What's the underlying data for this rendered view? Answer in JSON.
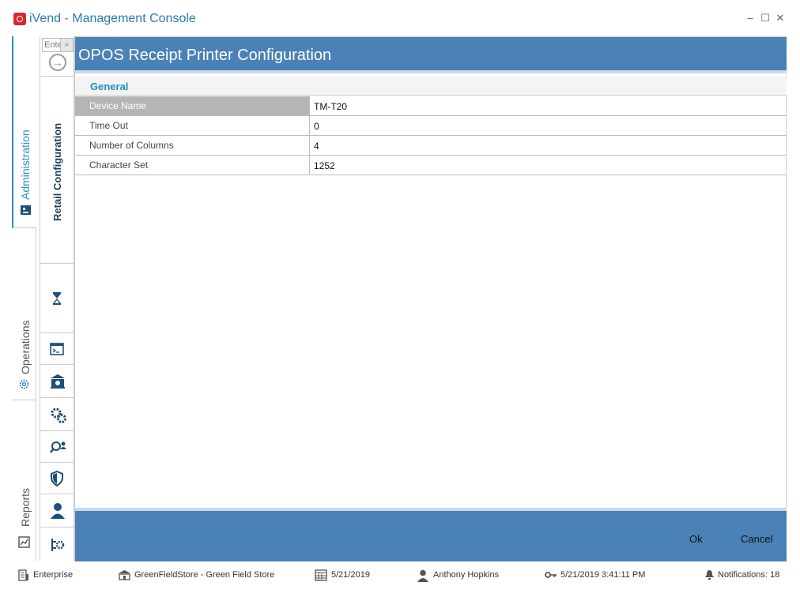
{
  "app": {
    "title": "iVend - Management Console"
  },
  "window": {
    "minimize": "‒",
    "maximize": "☐",
    "close": "✕"
  },
  "modules": [
    {
      "label": "Administration",
      "icon": "admin-icon",
      "active": true
    },
    {
      "label": "Operations",
      "icon": "gear-icon",
      "active": false
    },
    {
      "label": "Reports",
      "icon": "reports-icon",
      "active": false
    }
  ],
  "rail": {
    "search_placeholder": "Enter",
    "search_icon": "search-icon",
    "section_label": "Retail Configuration",
    "icons": [
      "hourglass-icon",
      "terminal-icon",
      "bank-icon",
      "settings-cogs-icon",
      "search-user-icon",
      "shield-icon",
      "user-icon",
      "integration-icon"
    ]
  },
  "main": {
    "title": "OPOS Receipt Printer Configuration",
    "section": "General",
    "properties": [
      {
        "label": "Device Name",
        "value": "TM-T20",
        "selected": true
      },
      {
        "label": "Time Out",
        "value": "0",
        "selected": false
      },
      {
        "label": "Number of Columns",
        "value": "4",
        "selected": false
      },
      {
        "label": "Character Set",
        "value": "1252",
        "selected": false
      }
    ],
    "ok_label": "Ok",
    "cancel_label": "Cancel"
  },
  "status": {
    "enterprise": "Enterprise",
    "store": "GreenFieldStore - Green Field Store",
    "date": "5/21/2019",
    "user": "Anthony Hopkins",
    "login_time": "5/21/2019 3:41:11 PM",
    "notifications": "Notifications: 18"
  },
  "colors": {
    "accent": "#4a81b7",
    "title": "#2a7ab7",
    "section": "#1c8dc6",
    "brand": "#d9262c"
  }
}
